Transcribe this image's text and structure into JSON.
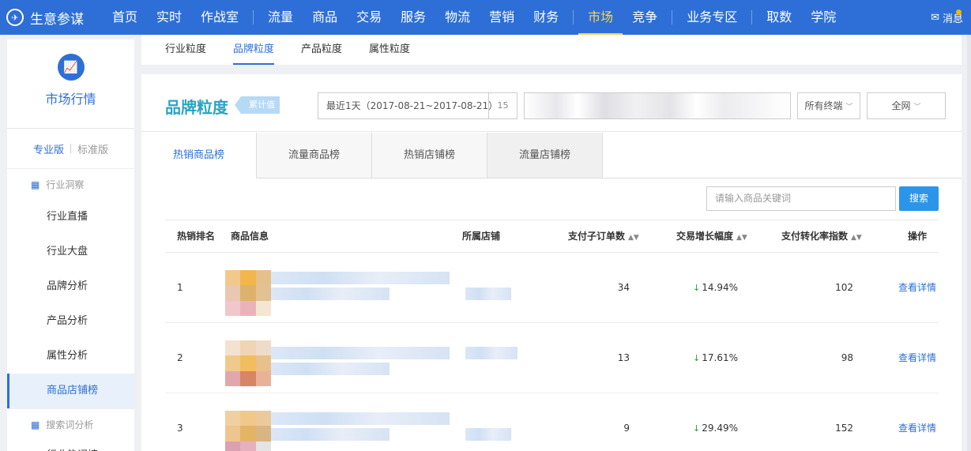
{
  "topnav": {
    "brand": "生意参谋",
    "brand_icon": "compass-icon",
    "items": [
      "首页",
      "实时",
      "作战室",
      "流量",
      "商品",
      "交易",
      "服务",
      "物流",
      "营销",
      "财务",
      "市场",
      "竞争",
      "业务专区",
      "取数",
      "学院"
    ],
    "active": "市场",
    "message": "消息"
  },
  "sidebar": {
    "logo_icon": "chart-icon",
    "title": "市场行情",
    "version_pro": "专业版",
    "version_std": "标准版",
    "group1": "行业洞察",
    "items": [
      "行业直播",
      "行业大盘",
      "品牌分析",
      "产品分析",
      "属性分析",
      "商品店铺榜"
    ],
    "active_item": "商品店铺榜",
    "group2": "搜索词分析",
    "partial_item": "行业热词榜"
  },
  "subtabs": {
    "items": [
      "行业粒度",
      "品牌粒度",
      "产品粒度",
      "属性粒度"
    ],
    "active": "品牌粒度"
  },
  "header": {
    "title": "品牌粒度",
    "tag": "累计值",
    "date_range": "最近1天（2017-08-21~2017-08-21）",
    "calendar_day": "15",
    "terminal": "所有终端",
    "channel": "全网"
  },
  "list_tabs": {
    "items": [
      "热销商品榜",
      "流量商品榜",
      "热销店铺榜",
      "流量店铺榜"
    ],
    "active": "热销商品榜"
  },
  "search": {
    "placeholder": "请输入商品关键词",
    "button": "搜索"
  },
  "table": {
    "headers": {
      "rank": "热销排名",
      "item": "商品信息",
      "shop": "所属店铺",
      "orders": "支付子订单数",
      "growth": "交易增长幅度",
      "conversion": "支付转化率指数",
      "action": "操作"
    },
    "rows": [
      {
        "rank": "1",
        "orders": "34",
        "growth": "14.94%",
        "conversion": "102",
        "action": "查看详情"
      },
      {
        "rank": "2",
        "orders": "13",
        "growth": "17.61%",
        "conversion": "98",
        "action": "查看详情"
      },
      {
        "rank": "3",
        "orders": "9",
        "growth": "29.49%",
        "conversion": "152",
        "action": "查看详情"
      }
    ]
  },
  "colors": {
    "brand_blue": "#2d6fd6",
    "active_nav": "#ffd24a",
    "title_teal": "#2aa3c4",
    "growth_green": "#2a9c47"
  }
}
